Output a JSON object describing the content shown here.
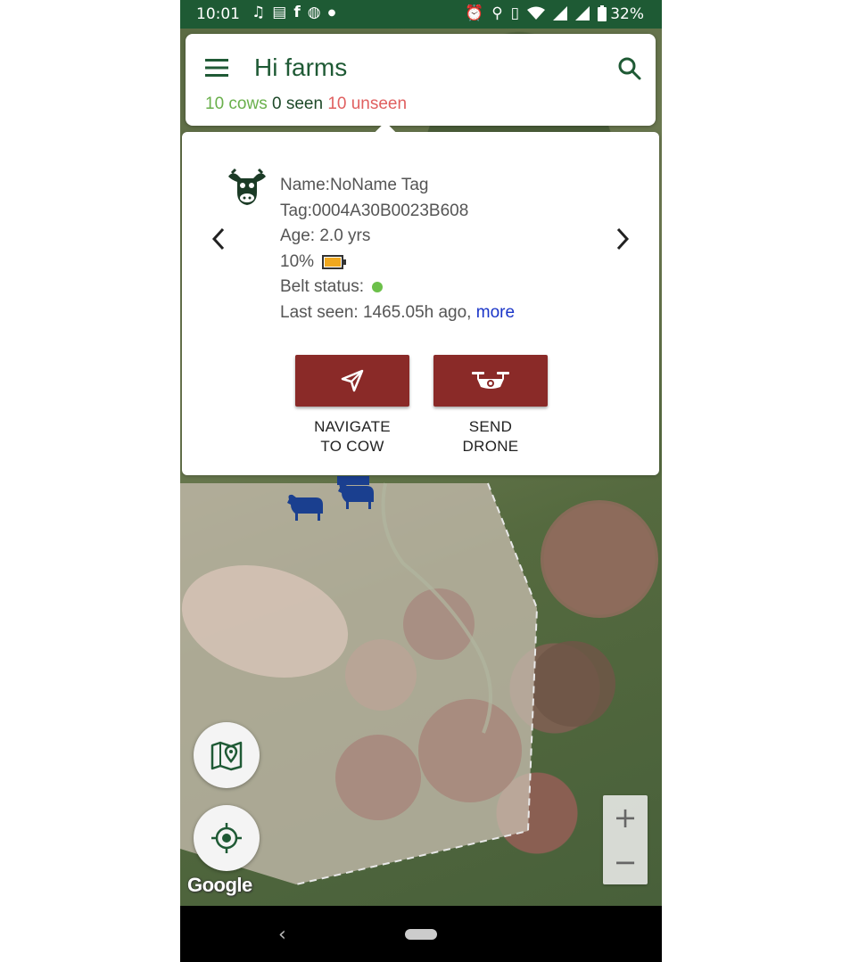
{
  "status_bar": {
    "time": "10:01",
    "battery": "32%",
    "icons_left": [
      "music-note-icon",
      "news-icon",
      "facebook-icon",
      "game-icon",
      "dot-icon"
    ],
    "icons_right": [
      "alarm-icon",
      "location-icon",
      "vibrate-icon",
      "wifi-icon",
      "signal-icon",
      "signal-icon",
      "battery-icon"
    ]
  },
  "header": {
    "title": "Hi farms",
    "cows_count": "10 cows",
    "seen_count": "0 seen",
    "unseen_count": "10 unseen"
  },
  "cow_info": {
    "name": "Name:NoName Tag",
    "tag": "Tag:0004A30B0023B608",
    "age": "Age: 2.0 yrs",
    "battery": "10%",
    "belt_status_label": "Belt status:",
    "last_seen": "Last seen: 1465.05h ago,",
    "more_link": "more"
  },
  "actions": {
    "navigate_line1": "NAVIGATE",
    "navigate_line2": "TO COW",
    "drone_line1": "SEND",
    "drone_line2": "DRONE"
  },
  "map": {
    "attribution": "Google",
    "zoom_in": "+",
    "zoom_out": "−"
  },
  "colors": {
    "primary_green": "#1f5a35",
    "seen_green": "#6ab04c",
    "unseen_red": "#e06060",
    "action_red": "#8a2a28",
    "link_blue": "#1a35c8",
    "cow_marker_blue": "#1a3f8f"
  }
}
